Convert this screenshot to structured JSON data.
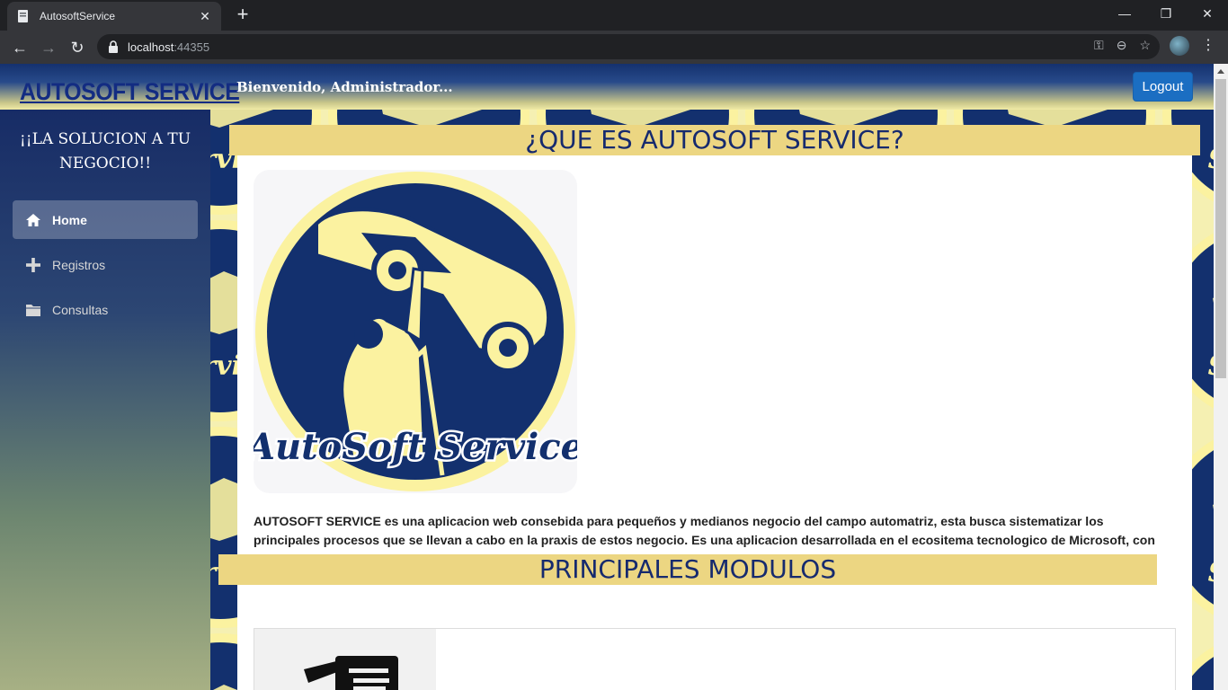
{
  "browser": {
    "tab_title": "AutosoftService",
    "url_host": "localhost",
    "url_port": ":44355"
  },
  "header": {
    "brand": "AUTOSOFT SERVICE",
    "welcome": "Bienvenido, Administrador...",
    "logout_label": "Logout"
  },
  "sidebar": {
    "slogan_line1": "¡¡LA SOLUCION A TU",
    "slogan_line2": "NEGOCIO!!",
    "items": [
      {
        "label": "Home",
        "icon": "home-icon",
        "active": true
      },
      {
        "label": "Registros",
        "icon": "plus-icon",
        "active": false
      },
      {
        "label": "Consultas",
        "icon": "folder-icon",
        "active": false
      }
    ]
  },
  "main": {
    "title": "¿QUE ES AUTOSOFT SERVICE?",
    "logo_text": "AutoSoft Service",
    "description": "AUTOSOFT SERVICE es una aplicacion web consebida para pequeños y medianos negocio del campo automatriz, esta busca sistematizar los principales procesos que se llevan a cabo en la praxis de estos negocio. Es una aplicacion desarrollada en el ecositema tecnologico de Microsoft, con tecnologias tendencias como son ASP.NET CORE, SQL Server y Blazor Server.",
    "modules_title": "PRINCIPALES MODULOS"
  },
  "colors": {
    "navy": "#14316e",
    "banner": "#ecd682",
    "logo_yellow": "#fbf2a0",
    "logout_blue": "#1b6ec2"
  }
}
